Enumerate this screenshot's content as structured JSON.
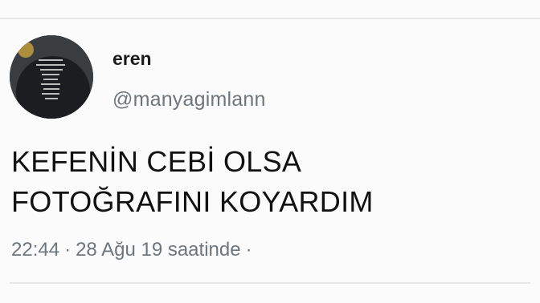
{
  "tweet": {
    "display_name": "eren",
    "handle": "@manyagimlann",
    "text_lines": [
      "KEFENİN CEBİ OLSA",
      "FOTOĞRAFINI KOYARDIM"
    ],
    "time": "22:44",
    "separator": "·",
    "date": "28 Ağu 19 saatinde",
    "trailing_separator": "·"
  },
  "colors": {
    "text_primary": "#111111",
    "text_secondary": "#6e767d",
    "divider": "#e8e8e8",
    "avatar_bg": "#2b2f33"
  },
  "icons": {
    "avatar": "profile-avatar"
  }
}
